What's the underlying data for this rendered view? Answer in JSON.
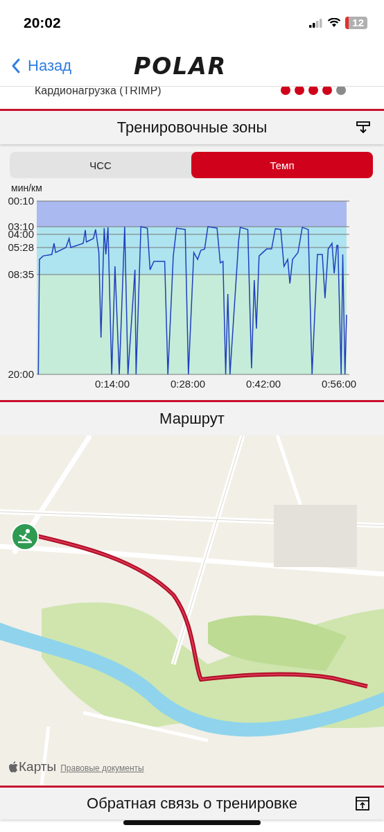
{
  "status_bar": {
    "time": "20:02",
    "battery": "12"
  },
  "nav": {
    "back": "Назад",
    "logo": "POLAR"
  },
  "trimp": {
    "label": "Кардионагрузка (TRIMP)",
    "stars": 4
  },
  "zones": {
    "title": "Тренировочные зоны",
    "tabs": [
      {
        "label": "ЧСС",
        "selected": false
      },
      {
        "label": "Темп",
        "selected": true
      }
    ],
    "chart_data": {
      "type": "line",
      "ylabel": "мин/км",
      "yticks": [
        {
          "value": 10,
          "label": "00:10"
        },
        {
          "value": 190,
          "label": "03:10"
        },
        {
          "value": 240,
          "label": "04:00"
        },
        {
          "value": 328,
          "label": "05:28"
        },
        {
          "value": 515,
          "label": "08:35"
        },
        {
          "value": 1200,
          "label": "20:00"
        }
      ],
      "xticks": [
        {
          "value": 14,
          "label": "0:14:00"
        },
        {
          "value": 28,
          "label": "0:28:00"
        },
        {
          "value": 42,
          "label": "0:42:00"
        },
        {
          "value": 56,
          "label": "0:56:00"
        }
      ],
      "xlim": [
        0,
        57.4
      ],
      "ylim": [
        1200,
        10
      ],
      "grid": true,
      "x": [
        0.3,
        0.5,
        1.2,
        2.8,
        3.2,
        3.5,
        5.4,
        6.0,
        6.3,
        8.6,
        9.0,
        9.2,
        10.5,
        10.9,
        11.5,
        11.9,
        12.5,
        12.8,
        13.2,
        13.9,
        14.5,
        15.3,
        16.3,
        16.9,
        18.2,
        18.4,
        19.3,
        20.5,
        21.0,
        21.7,
        23.7,
        24.3,
        25.3,
        25.9,
        27.5,
        28.1,
        29.1,
        29.8,
        30.4,
        31.1,
        31.7,
        33.4,
        34.0,
        34.5,
        35.0,
        35.4,
        35.8,
        37.4,
        37.7,
        39.1,
        39.8,
        40.3,
        40.7,
        41.2,
        42.6,
        43.5,
        44.2,
        45.2,
        45.8,
        46.5,
        46.9,
        47.4,
        48.4,
        49.2,
        50.3,
        51.0,
        52.0,
        52.9,
        53.4,
        54.0,
        54.7,
        55.1,
        55.6,
        55.8,
        56.4,
        56.7,
        57.1,
        57.4
      ],
      "series": [
        {
          "color": "#1f3fbf",
          "values": [
            1200,
            410,
            386,
            376,
            300,
            362,
            328,
            268,
            328,
            300,
            212,
            291,
            268,
            208,
            362,
            948,
            199,
            376,
            194,
            1200,
            458,
            1200,
            190,
            1200,
            482,
            1200,
            190,
            199,
            482,
            424,
            424,
            1200,
            386,
            199,
            208,
            1200,
            362,
            410,
            347,
            338,
            190,
            199,
            434,
            424,
            1200,
            648,
            1200,
            282,
            194,
            208,
            1158,
            553,
            886,
            386,
            338,
            338,
            203,
            208,
            458,
            410,
            577,
            410,
            362,
            194,
            208,
            1200,
            376,
            376,
            677,
            338,
            300,
            506,
            314,
            314,
            1200,
            376,
            1200,
            791
          ]
        }
      ]
    }
  },
  "route": {
    "title": "Маршрут",
    "maps_label": "Карты",
    "legal_link": "Правовые документы"
  },
  "feedback": {
    "title": "Обратная связь о тренировке"
  }
}
